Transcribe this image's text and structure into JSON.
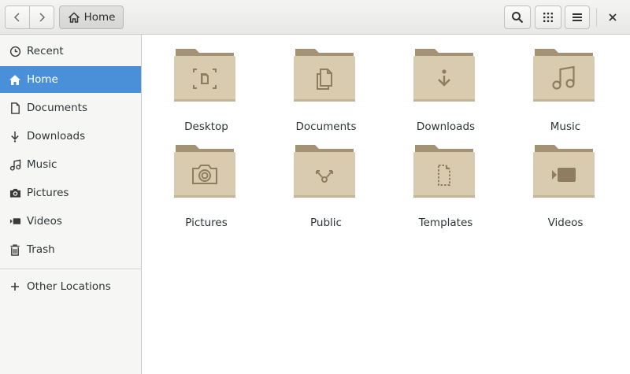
{
  "header": {
    "path_home_label": "Home",
    "back_icon": "chevron-left-icon",
    "forward_icon": "chevron-right-icon",
    "search_icon": "search-icon",
    "view_icon": "grid-view-icon",
    "menu_icon": "hamburger-menu-icon",
    "close_icon": "close-icon"
  },
  "sidebar": {
    "items": [
      {
        "label": "Recent",
        "icon": "clock-icon",
        "active": false
      },
      {
        "label": "Home",
        "icon": "home-icon",
        "active": true
      },
      {
        "label": "Documents",
        "icon": "document-icon",
        "active": false
      },
      {
        "label": "Downloads",
        "icon": "download-icon",
        "active": false
      },
      {
        "label": "Music",
        "icon": "music-icon",
        "active": false
      },
      {
        "label": "Pictures",
        "icon": "camera-icon",
        "active": false
      },
      {
        "label": "Videos",
        "icon": "video-icon",
        "active": false
      },
      {
        "label": "Trash",
        "icon": "trash-icon",
        "active": false
      }
    ],
    "other_locations": {
      "label": "Other Locations",
      "icon": "plus-icon"
    }
  },
  "folders": [
    {
      "label": "Desktop",
      "icon": "desktop-emblem-icon"
    },
    {
      "label": "Documents",
      "icon": "documents-emblem-icon"
    },
    {
      "label": "Downloads",
      "icon": "downloads-emblem-icon"
    },
    {
      "label": "Music",
      "icon": "music-emblem-icon"
    },
    {
      "label": "Pictures",
      "icon": "camera-emblem-icon"
    },
    {
      "label": "Public",
      "icon": "share-emblem-icon"
    },
    {
      "label": "Templates",
      "icon": "template-emblem-icon"
    },
    {
      "label": "Videos",
      "icon": "video-emblem-icon"
    }
  ],
  "colors": {
    "accent": "#4a90d9",
    "folder_body": "#d9cbb0",
    "folder_back": "#a39274",
    "emblem": "#8e7d61"
  }
}
